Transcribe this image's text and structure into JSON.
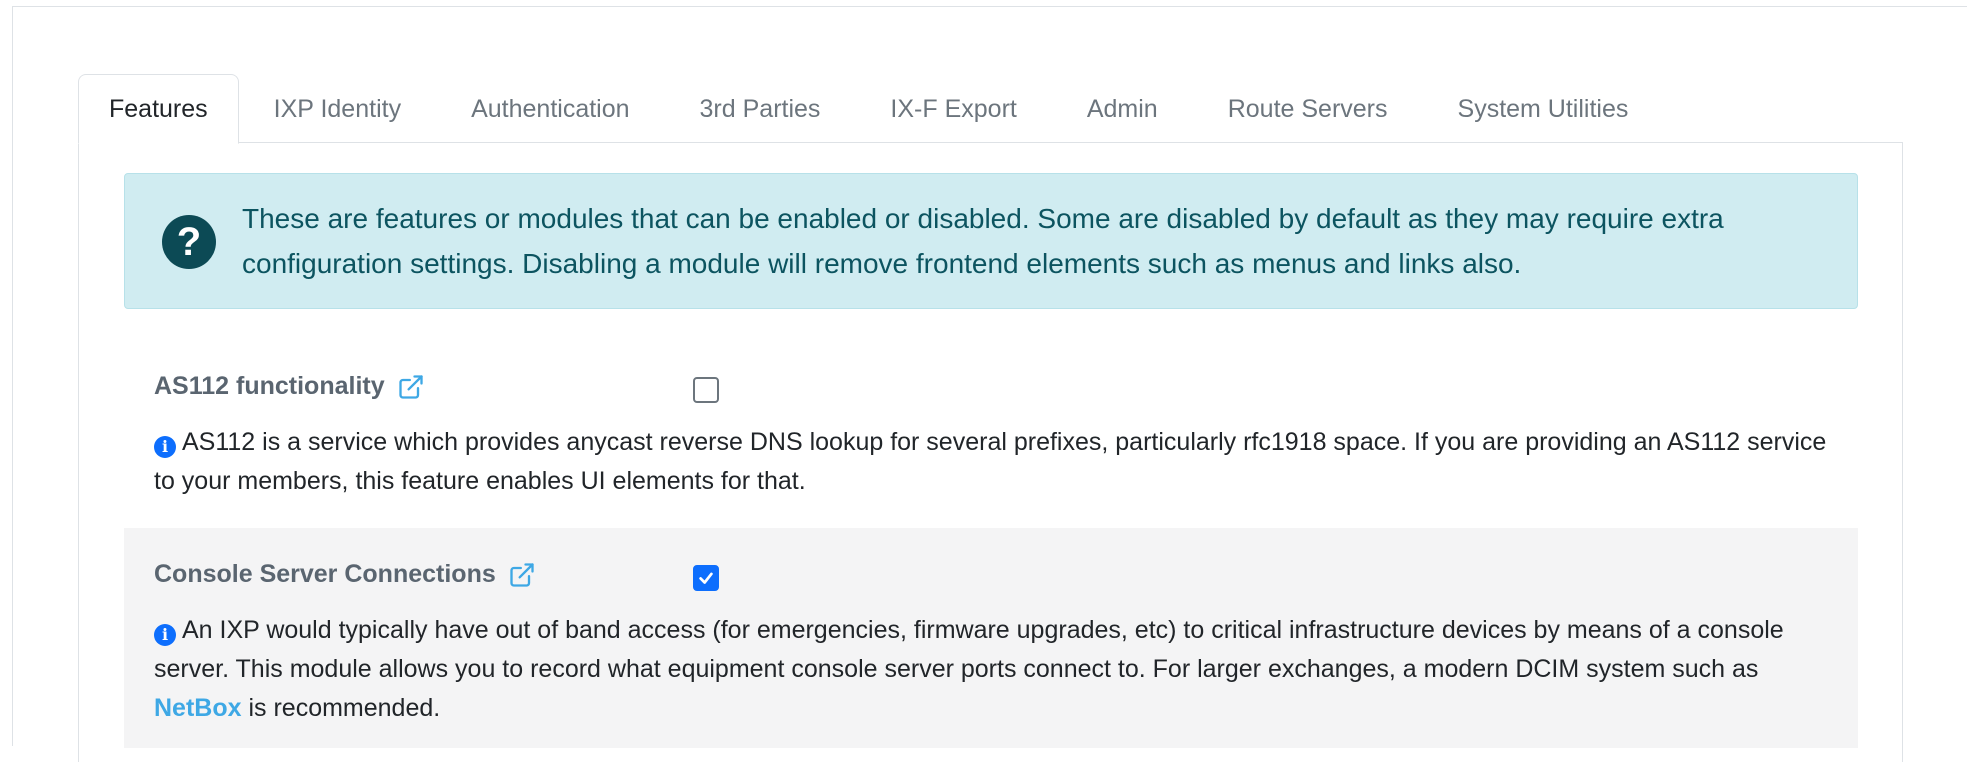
{
  "tabs": [
    {
      "label": "Features"
    },
    {
      "label": "IXP Identity"
    },
    {
      "label": "Authentication"
    },
    {
      "label": "3rd Parties"
    },
    {
      "label": "IX-F Export"
    },
    {
      "label": "Admin"
    },
    {
      "label": "Route Servers"
    },
    {
      "label": "System Utilities"
    }
  ],
  "info": {
    "text": "These are features or modules that can be enabled or disabled. Some are disabled by default as they may require extra configuration settings. Disabling a module will remove frontend elements such as menus and links also."
  },
  "features": [
    {
      "title": "AS112 functionality",
      "checked": false,
      "description": "AS112 is a service which provides anycast reverse DNS lookup for several prefixes, particularly rfc1918 space. If you are providing an AS112 service to your members, this feature enables UI elements for that."
    },
    {
      "title": "Console Server Connections",
      "checked": true,
      "description_before": "An IXP would typically have out of band access (for emergencies, firmware upgrades, etc) to critical infrastructure devices by means of a console server. This module allows you to record what equipment console server ports connect to. For larger exchanges, a modern DCIM system such as",
      "link_text": "NetBox",
      "description_after": "is recommended."
    }
  ],
  "colors": {
    "accent": "#0d6efd",
    "link": "#3ea8e5",
    "info_bg": "#d0ecf1",
    "info_text": "#0c5460"
  }
}
